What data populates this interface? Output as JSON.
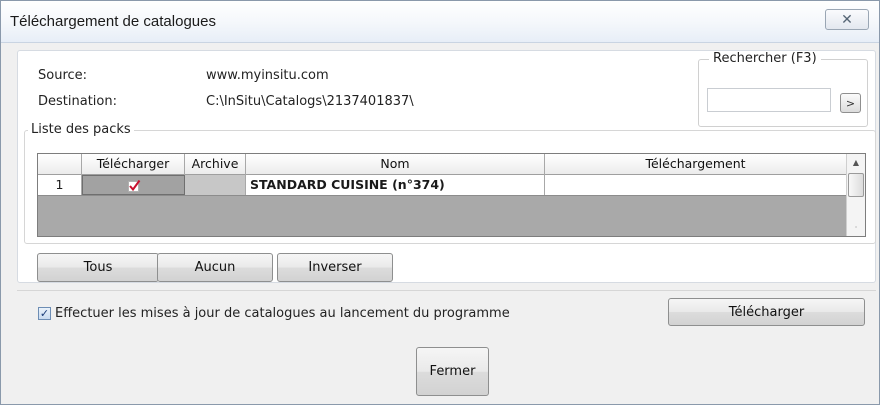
{
  "window": {
    "title": "Téléchargement de catalogues",
    "close_glyph": "✕"
  },
  "info": {
    "source_label": "Source:",
    "source_value": "www.myinsitu.com",
    "destination_label": "Destination:",
    "destination_value": "C:\\InSitu\\Catalogs\\2137401837\\"
  },
  "search": {
    "label": "Rechercher (F3)",
    "value": "",
    "placeholder": "",
    "go_label": ">"
  },
  "packs": {
    "group_label": "Liste des packs",
    "columns": [
      "",
      "Télécharger",
      "Archive",
      "Nom",
      "Téléchargement"
    ],
    "rows": [
      {
        "index": "1",
        "telecharger_checked": true,
        "telecharger_icon": "red-check-icon",
        "archive": "",
        "nom": "STANDARD CUISINE (n°374)",
        "telechargement": ""
      }
    ]
  },
  "selection_buttons": {
    "tous": "Tous",
    "aucun": "Aucun",
    "inverser": "Inverser"
  },
  "auto_update": {
    "checked": true,
    "label": "Effectuer les mises à jour de catalogues au lancement du programme"
  },
  "actions": {
    "download_label": "Télécharger",
    "close_label": "Fermer"
  },
  "colors": {
    "accent_check": "#c8102e",
    "grid_background": "#a9a9a9",
    "window_background": "#f0f0f0"
  }
}
